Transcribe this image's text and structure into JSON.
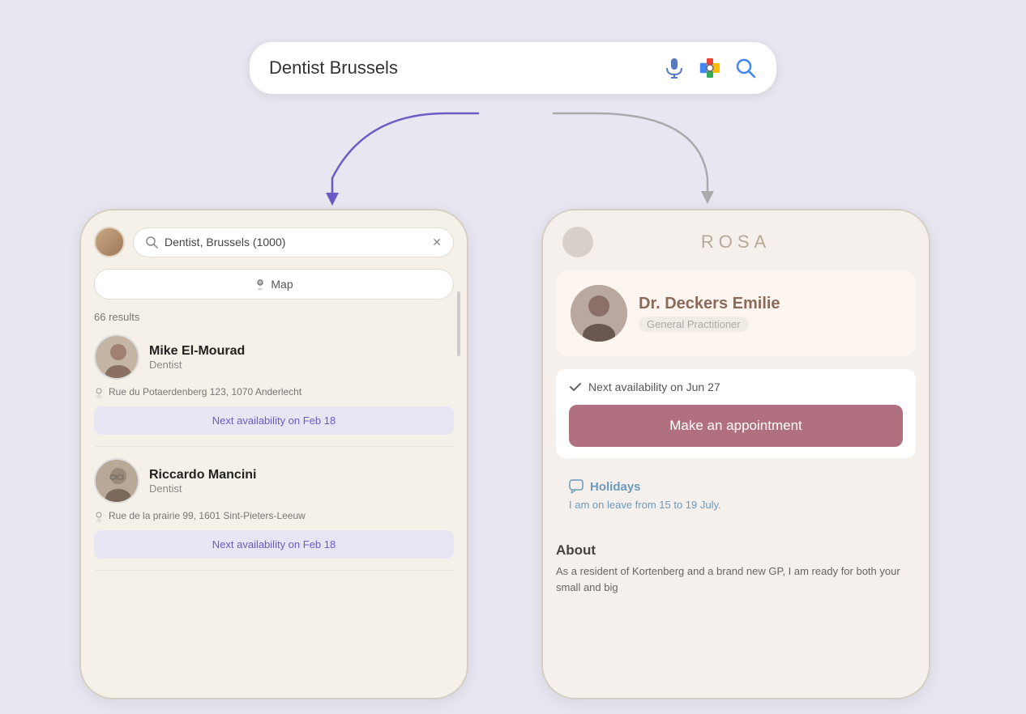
{
  "search": {
    "query": "Dentist Brussels",
    "placeholder": "Dentist Brussels"
  },
  "left_phone": {
    "search_text": "Dentist, Brussels (1000)",
    "map_button": "Map",
    "results_count": "66 results",
    "doctors": [
      {
        "name": "Mike El-Mourad",
        "specialty": "Dentist",
        "address": "Rue du Potaerdenberg 123, 1070 Anderlecht",
        "availability": "Next availability on Feb 18"
      },
      {
        "name": "Riccardo Mancini",
        "specialty": "Dentist",
        "address": "Rue de la prairie 99, 1601 Sint-Pieters-Leeuw",
        "availability": "Next availability on Feb 18"
      }
    ]
  },
  "right_phone": {
    "logo": "ROSA",
    "doctor": {
      "name": "Dr. Deckers Emilie",
      "specialty": "General Practitioner",
      "availability": "Next availability on Jun 27",
      "appointment_btn": "Make an appointment"
    },
    "holidays": {
      "title": "Holidays",
      "text": "I am on leave from 15 to 19 July."
    },
    "about": {
      "title": "About",
      "text": "As a resident of Kortenberg and a brand new GP, I am ready for both your small and big"
    }
  },
  "icons": {
    "mic": "🎤",
    "lens": "⊡",
    "search": "🔍",
    "map_pin": "📍",
    "check": "✓",
    "chat": "💬"
  }
}
